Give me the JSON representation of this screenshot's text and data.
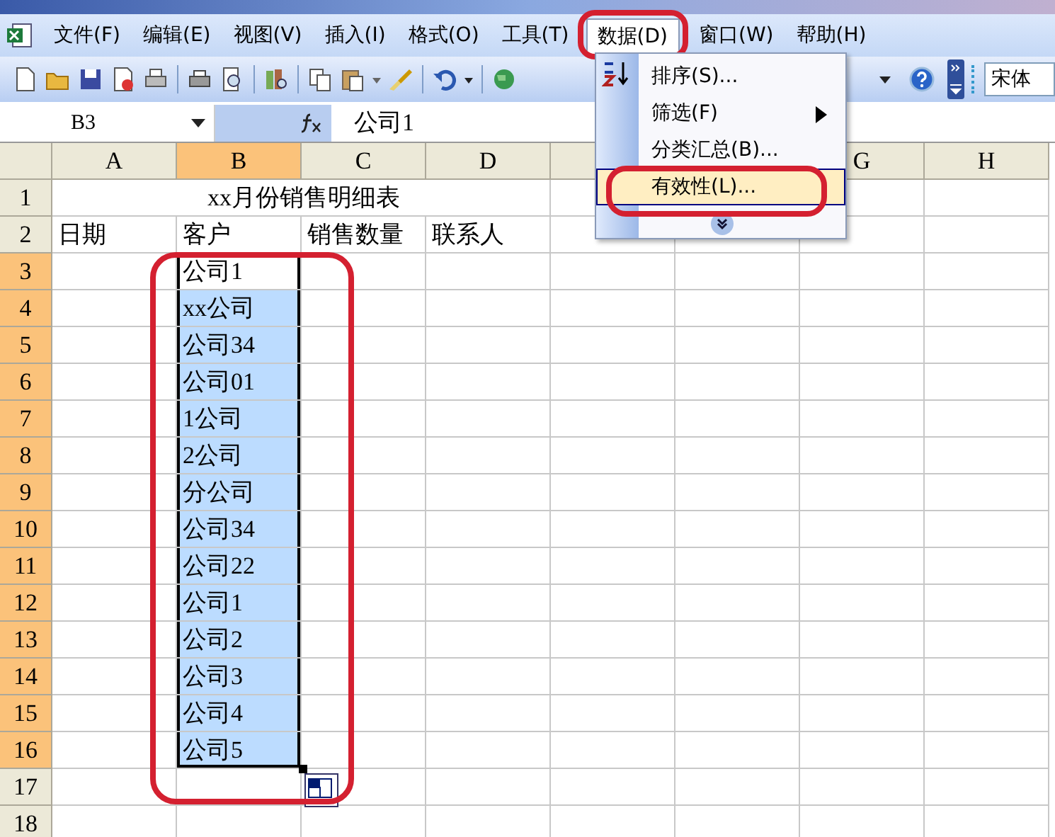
{
  "menu_bar": [
    {
      "label": "文件(F)",
      "selected": false
    },
    {
      "label": "编辑(E)",
      "selected": false
    },
    {
      "label": "视图(V)",
      "selected": false
    },
    {
      "label": "插入(I)",
      "selected": false
    },
    {
      "label": "格式(O)",
      "selected": false
    },
    {
      "label": "工具(T)",
      "selected": false
    },
    {
      "label": "数据(D)",
      "selected": true
    },
    {
      "label": "窗口(W)",
      "selected": false
    },
    {
      "label": "帮助(H)",
      "selected": false
    }
  ],
  "toolbar": {
    "font_name": "宋体"
  },
  "formula_bar": {
    "name_box": "B3",
    "value": "公司1"
  },
  "columns": [
    {
      "kind": "header",
      "label": "A",
      "selected": false
    },
    {
      "kind": "header",
      "label": "B",
      "selected": true
    },
    {
      "kind": "header",
      "label": "C",
      "selected": false
    },
    {
      "kind": "header",
      "label": "D",
      "selected": false
    },
    {
      "kind": "partial"
    },
    {
      "kind": "covered"
    },
    {
      "kind": "header",
      "label": "G",
      "selected": false
    },
    {
      "kind": "header",
      "label": "H",
      "selected": false
    }
  ],
  "rows": [
    {
      "kind": "title",
      "header": "1",
      "selected": false,
      "title": "xx月份销售明细表"
    },
    {
      "kind": "headings",
      "header": "2",
      "selected": false,
      "cells": [
        "日期",
        "客户",
        "销售数量",
        "联系人"
      ]
    },
    {
      "kind": "data",
      "header": "3",
      "selected": true,
      "active": true,
      "customer": "公司1"
    },
    {
      "kind": "data",
      "header": "4",
      "selected": true,
      "active": false,
      "customer": "xx公司"
    },
    {
      "kind": "data",
      "header": "5",
      "selected": true,
      "active": false,
      "customer": "公司34"
    },
    {
      "kind": "data",
      "header": "6",
      "selected": true,
      "active": false,
      "customer": "公司01"
    },
    {
      "kind": "data",
      "header": "7",
      "selected": true,
      "active": false,
      "customer": "1公司"
    },
    {
      "kind": "data",
      "header": "8",
      "selected": true,
      "active": false,
      "customer": "2公司"
    },
    {
      "kind": "data",
      "header": "9",
      "selected": true,
      "active": false,
      "customer": "分公司"
    },
    {
      "kind": "data",
      "header": "10",
      "selected": true,
      "active": false,
      "customer": "公司34"
    },
    {
      "kind": "data",
      "header": "11",
      "selected": true,
      "active": false,
      "customer": "公司22"
    },
    {
      "kind": "data",
      "header": "12",
      "selected": true,
      "active": false,
      "customer": "公司1"
    },
    {
      "kind": "data",
      "header": "13",
      "selected": true,
      "active": false,
      "customer": "公司2"
    },
    {
      "kind": "data",
      "header": "14",
      "selected": true,
      "active": false,
      "customer": "公司3"
    },
    {
      "kind": "data",
      "header": "15",
      "selected": true,
      "active": false,
      "customer": "公司4"
    },
    {
      "kind": "data",
      "header": "16",
      "selected": true,
      "active": false,
      "customer": "公司5"
    },
    {
      "kind": "empty",
      "header": "17",
      "selected": false
    },
    {
      "kind": "empty",
      "header": "18",
      "selected": false
    }
  ],
  "data_menu": {
    "items": [
      {
        "label": "排序(S)...",
        "selected": false,
        "has_submenu": false
      },
      {
        "label": "筛选(F)",
        "selected": false,
        "has_submenu": true
      },
      {
        "label": "分类汇总(B)...",
        "selected": false,
        "has_submenu": false
      },
      {
        "label": "有效性(L)...",
        "selected": true,
        "has_submenu": false
      }
    ]
  }
}
